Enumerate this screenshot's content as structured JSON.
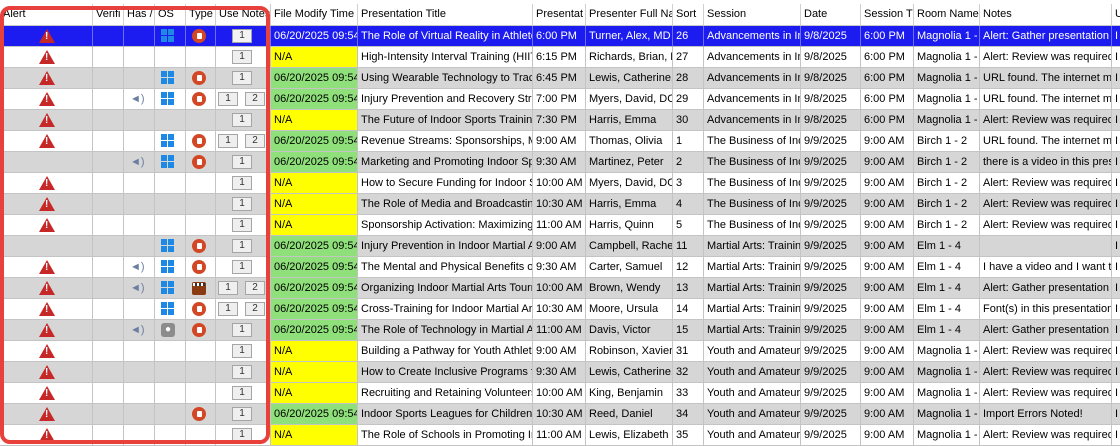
{
  "columns": {
    "alert": "Alert",
    "verified": "Verifi",
    "has_audio": "Has /",
    "os": "OS",
    "type": "Type",
    "use_notes": "Use Notes",
    "file_modify_time": "File Modify Time",
    "presentation_title": "Presentation Title",
    "presentation_time": "Presentat",
    "presenter": "Presenter Full Na",
    "sort": "Sort",
    "session": "Session",
    "date": "Date",
    "session_time": "Session T",
    "room": "Room Name",
    "notes": "Notes",
    "extra": "U"
  },
  "rows": [
    {
      "alert": true,
      "audio": false,
      "os": "windows",
      "type": "powerpoint",
      "box1": "1",
      "box2": "",
      "fm": "06/20/2025 09:54",
      "fm_color": "selected",
      "title": "The Role of Virtual Reality in Athlete",
      "time": "6:00 PM",
      "presenter": "Turner, Alex, MD",
      "sort": "26",
      "session": "Advancements in In",
      "date": "9/8/2025",
      "stime": "6:00 PM",
      "room": "Magnolia 1 -",
      "notes": "Alert: Gather presentation f",
      "extra": "I",
      "bg": "sel"
    },
    {
      "alert": true,
      "audio": false,
      "os": "",
      "type": "",
      "box1": "1",
      "box2": "",
      "fm": "N/A",
      "fm_color": "yellow",
      "title": "High-Intensity Interval Training (HIIT",
      "time": "6:15 PM",
      "presenter": "Richards, Brian, M",
      "sort": "27",
      "session": "Advancements in In",
      "date": "9/8/2025",
      "stime": "6:00 PM",
      "room": "Magnolia 1 -",
      "notes": "Alert: Review was required (",
      "extra": "I",
      "bg": "white"
    },
    {
      "alert": true,
      "audio": false,
      "os": "windows",
      "type": "powerpoint",
      "box1": "1",
      "box2": "",
      "fm": "06/20/2025 09:54",
      "fm_color": "green",
      "title": "Using Wearable Technology to Track",
      "time": "6:45 PM",
      "presenter": "Lewis, Catherine, I",
      "sort": "28",
      "session": "Advancements in In",
      "date": "9/8/2025",
      "stime": "6:00 PM",
      "room": "Magnolia 1 -",
      "notes": "URL found. The internet ma",
      "extra": "I",
      "bg": "gray"
    },
    {
      "alert": true,
      "audio": true,
      "os": "windows",
      "type": "powerpoint",
      "box1": "1",
      "box2": "2",
      "fm": "06/20/2025 09:54",
      "fm_color": "green",
      "title": "Injury Prevention and Recovery Strate",
      "time": "7:00 PM",
      "presenter": "Myers, David, DO",
      "sort": "29",
      "session": "Advancements in In",
      "date": "9/8/2025",
      "stime": "6:00 PM",
      "room": "Magnolia 1 -",
      "notes": "URL found. The internet ma",
      "extra": "I",
      "bg": "white"
    },
    {
      "alert": true,
      "audio": false,
      "os": "",
      "type": "",
      "box1": "1",
      "box2": "",
      "fm": "N/A",
      "fm_color": "yellow",
      "title": "The Future of Indoor Sports Training:",
      "time": "7:30 PM",
      "presenter": "Harris, Emma",
      "sort": "30",
      "session": "Advancements in In",
      "date": "9/8/2025",
      "stime": "6:00 PM",
      "room": "Magnolia 1 -",
      "notes": "Alert: Review was required (",
      "extra": "I",
      "bg": "gray"
    },
    {
      "alert": true,
      "audio": false,
      "os": "windows",
      "type": "powerpoint",
      "box1": "1",
      "box2": "2",
      "fm": "06/20/2025 09:54",
      "fm_color": "green",
      "title": "Revenue Streams: Sponsorships, Mer",
      "time": "9:00 AM",
      "presenter": "Thomas, Olivia",
      "sort": "1",
      "session": "The Business of Indo",
      "date": "9/9/2025",
      "stime": "9:00 AM",
      "room": "Birch 1 - 2",
      "notes": "URL found. The internet ma",
      "extra": "I",
      "bg": "white"
    },
    {
      "alert": false,
      "audio": true,
      "os": "windows",
      "type": "powerpoint",
      "box1": "1",
      "box2": "",
      "fm": "06/20/2025 09:54",
      "fm_color": "green",
      "title": "Marketing and Promoting Indoor Spo",
      "time": "9:30 AM",
      "presenter": "Martinez, Peter",
      "sort": "2",
      "session": "The Business of Indo",
      "date": "9/9/2025",
      "stime": "9:00 AM",
      "room": "Birch 1 - 2",
      "notes": "there is a video in this prese",
      "extra": "I",
      "bg": "gray"
    },
    {
      "alert": true,
      "audio": false,
      "os": "",
      "type": "",
      "box1": "1",
      "box2": "",
      "fm": "N/A",
      "fm_color": "yellow",
      "title": "How to Secure Funding for Indoor Sp",
      "time": "10:00 AM",
      "presenter": "Myers, David, DO",
      "sort": "3",
      "session": "The Business of Indo",
      "date": "9/9/2025",
      "stime": "9:00 AM",
      "room": "Birch 1 - 2",
      "notes": "Alert: Review was required (",
      "extra": "I",
      "bg": "white"
    },
    {
      "alert": true,
      "audio": false,
      "os": "",
      "type": "",
      "box1": "1",
      "box2": "",
      "fm": "N/A",
      "fm_color": "yellow",
      "title": "The Role of Media and Broadcasting",
      "time": "10:30 AM",
      "presenter": "Harris, Emma",
      "sort": "4",
      "session": "The Business of Indo",
      "date": "9/9/2025",
      "stime": "9:00 AM",
      "room": "Birch 1 - 2",
      "notes": "Alert: Review was required (",
      "extra": "I",
      "bg": "gray"
    },
    {
      "alert": true,
      "audio": false,
      "os": "",
      "type": "",
      "box1": "1",
      "box2": "",
      "fm": "N/A",
      "fm_color": "yellow",
      "title": "Sponsorship Activation: Maximizing I",
      "time": "11:00 AM",
      "presenter": "Harris, Quinn",
      "sort": "5",
      "session": "The Business of Indo",
      "date": "9/9/2025",
      "stime": "9:00 AM",
      "room": "Birch 1 - 2",
      "notes": "Alert: Review was required (",
      "extra": "I",
      "bg": "white"
    },
    {
      "alert": false,
      "audio": false,
      "os": "windows",
      "type": "powerpoint",
      "box1": "1",
      "box2": "",
      "fm": "06/20/2025 09:54",
      "fm_color": "green",
      "title": "Injury Prevention in Indoor Martial A",
      "time": "9:00 AM",
      "presenter": "Campbell, Rachel",
      "sort": "11",
      "session": "Martial Arts: Trainin",
      "date": "9/9/2025",
      "stime": "9:00 AM",
      "room": "Elm 1 - 4",
      "notes": "",
      "extra": "I",
      "bg": "gray"
    },
    {
      "alert": true,
      "audio": true,
      "os": "windows",
      "type": "powerpoint",
      "box1": "1",
      "box2": "",
      "fm": "06/20/2025 09:54",
      "fm_color": "green",
      "title": "The Mental and Physical Benefits of I",
      "time": "9:30 AM",
      "presenter": "Carter, Samuel",
      "sort": "12",
      "session": "Martial Arts: Trainin",
      "date": "9/9/2025",
      "stime": "9:00 AM",
      "room": "Elm 1 - 4",
      "notes": "I have a video and I want to",
      "extra": "I",
      "bg": "white"
    },
    {
      "alert": true,
      "audio": true,
      "os": "windows",
      "type": "movie",
      "box1": "1",
      "box2": "2",
      "fm": "06/20/2025 09:54",
      "fm_color": "green",
      "title": "Organizing Indoor Martial Arts Tourn",
      "time": "10:00 AM",
      "presenter": "Brown, Wendy",
      "sort": "13",
      "session": "Martial Arts: Trainin",
      "date": "9/9/2025",
      "stime": "9:00 AM",
      "room": "Elm 1 - 4",
      "notes": "Alert: Gather presentation f",
      "extra": "I",
      "bg": "gray"
    },
    {
      "alert": true,
      "audio": false,
      "os": "windows",
      "type": "powerpoint",
      "box1": "1",
      "box2": "2",
      "fm": "06/20/2025 09:54",
      "fm_color": "green",
      "title": "Cross-Training for Indoor Martial Art",
      "time": "10:30 AM",
      "presenter": "Moore, Ursula",
      "sort": "14",
      "session": "Martial Arts: Trainin",
      "date": "9/9/2025",
      "stime": "9:00 AM",
      "room": "Elm 1 - 4",
      "notes": "Font(s) in this presentation",
      "extra": "I",
      "bg": "white"
    },
    {
      "alert": true,
      "audio": true,
      "os": "mac",
      "type": "powerpoint",
      "box1": "1",
      "box2": "",
      "fm": "06/20/2025 09:54",
      "fm_color": "green",
      "title": "The Role of Technology in Martial Art",
      "time": "11:00 AM",
      "presenter": "Davis, Victor",
      "sort": "15",
      "session": "Martial Arts: Trainin",
      "date": "9/9/2025",
      "stime": "9:00 AM",
      "room": "Elm 1 - 4",
      "notes": "Alert: Gather presentation f",
      "extra": "I",
      "bg": "gray"
    },
    {
      "alert": true,
      "audio": false,
      "os": "",
      "type": "",
      "box1": "1",
      "box2": "",
      "fm": "N/A",
      "fm_color": "yellow",
      "title": "Building a Pathway for Youth Athlete",
      "time": "9:00 AM",
      "presenter": "Robinson, Xavier",
      "sort": "31",
      "session": "Youth and Amateur",
      "date": "9/9/2025",
      "stime": "9:00 AM",
      "room": "Magnolia 1 -",
      "notes": "Alert: Review was required (",
      "extra": "I",
      "bg": "white"
    },
    {
      "alert": true,
      "audio": false,
      "os": "",
      "type": "",
      "box1": "1",
      "box2": "",
      "fm": "N/A",
      "fm_color": "yellow",
      "title": "How to Create Inclusive Programs fo",
      "time": "9:30 AM",
      "presenter": "Lewis, Catherine, I",
      "sort": "32",
      "session": "Youth and Amateur",
      "date": "9/9/2025",
      "stime": "9:00 AM",
      "room": "Magnolia 1 -",
      "notes": "Alert: Review was required (",
      "extra": "I",
      "bg": "gray"
    },
    {
      "alert": true,
      "audio": false,
      "os": "",
      "type": "",
      "box1": "1",
      "box2": "",
      "fm": "N/A",
      "fm_color": "yellow",
      "title": "Recruiting and Retaining Volunteers i",
      "time": "10:00 AM",
      "presenter": "King, Benjamin",
      "sort": "33",
      "session": "Youth and Amateur",
      "date": "9/9/2025",
      "stime": "9:00 AM",
      "room": "Magnolia 1 -",
      "notes": "Alert: Review was required (",
      "extra": "I",
      "bg": "white"
    },
    {
      "alert": true,
      "audio": false,
      "os": "",
      "type": "powerpoint",
      "box1": "1",
      "box2": "",
      "fm": "06/20/2025 09:54",
      "fm_color": "green",
      "title": "Indoor Sports Leagues for Children: I",
      "time": "10:30 AM",
      "presenter": "Reed, Daniel",
      "sort": "34",
      "session": "Youth and Amateur",
      "date": "9/9/2025",
      "stime": "9:00 AM",
      "room": "Magnolia 1 -",
      "notes": "Import Errors Noted!",
      "extra": "I",
      "bg": "gray"
    },
    {
      "alert": true,
      "audio": false,
      "os": "",
      "type": "",
      "box1": "1",
      "box2": "",
      "fm": "N/A",
      "fm_color": "yellow",
      "title": "The Role of Schools in Promoting Inc",
      "time": "11:00 AM",
      "presenter": "Lewis, Elizabeth",
      "sort": "35",
      "session": "Youth and Amateur",
      "date": "9/9/2025",
      "stime": "9:00 AM",
      "room": "Magnolia 1 -",
      "notes": "Alert: Review was required (",
      "extra": "I",
      "bg": "white"
    }
  ]
}
